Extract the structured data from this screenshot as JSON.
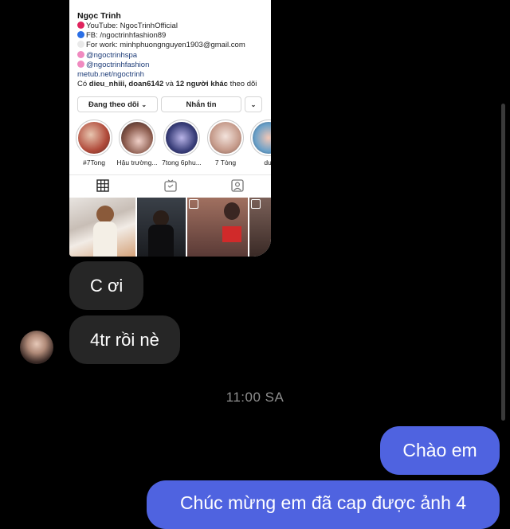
{
  "profile_card": {
    "name": "Ngọc Trinh",
    "bio": [
      {
        "icon": "red-circle-icon",
        "color": "#e0245e",
        "text": "YouTube: NgocTrinhOfficial"
      },
      {
        "icon": "blue-circle-icon",
        "color": "#2b6fe6",
        "text": "FB: /ngoctrinhfashion89"
      },
      {
        "icon": "white-circle-icon",
        "color": "#e9e9e9",
        "text": "For work: minhphuongnguyen1903@gmail.com"
      },
      {
        "icon": "flower-icon",
        "color": "#f08ac0",
        "text": "@ngoctrinhspa"
      },
      {
        "icon": "flower-icon",
        "color": "#f08ac0",
        "text": "@ngoctrinhfashion"
      }
    ],
    "website": "metub.net/ngoctrinh",
    "followed_by_prefix": "Có ",
    "followed_by_names": "dieu_nhiii, doan6142",
    "followed_by_mid": " và ",
    "followed_by_count": "12 người khác",
    "followed_by_suffix": " theo dõi",
    "following_button": "Đang theo dõi",
    "message_button": "Nhắn tin",
    "highlights": [
      {
        "label": "#7Tong",
        "color": "#b04a3a"
      },
      {
        "label": "Hậu trường...",
        "color": "#8a5a4c"
      },
      {
        "label": "7tong 6phu...",
        "color": "#3a3f7a"
      },
      {
        "label": "7 Tòng",
        "color": "#c59a8a"
      },
      {
        "label": "dul",
        "color": "#6aa0c8"
      }
    ]
  },
  "messages": {
    "in_1": "C ơi",
    "in_2": "4tr rồi nè",
    "timestamp": "11:00 SA",
    "out_1": "Chào em",
    "out_2": "Chúc mừng em đã cap được ảnh 4"
  },
  "colors": {
    "background": "#000000",
    "incoming_bubble": "#262626",
    "outgoing_bubble": "#4f63e0"
  }
}
